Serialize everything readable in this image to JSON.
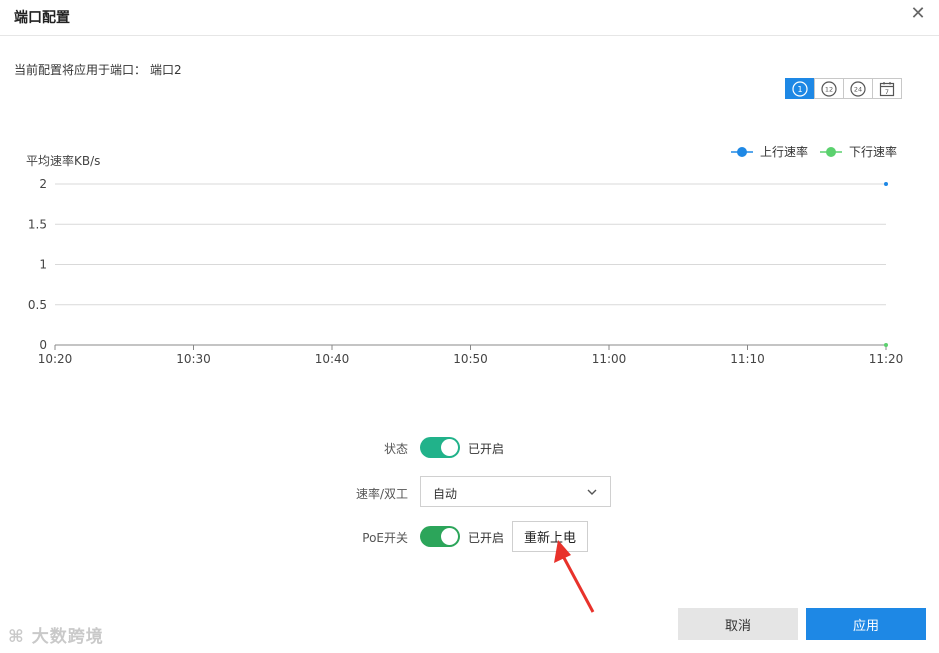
{
  "dialog": {
    "title": "端口配置",
    "close_glyph": "✕"
  },
  "port_info": {
    "label": "当前配置将应用于端口：",
    "port": "端口2"
  },
  "time_range": {
    "buttons": [
      {
        "icon": "clock-1-icon",
        "text": "1",
        "active": true
      },
      {
        "icon": "clock-12-icon",
        "text": "12",
        "active": false
      },
      {
        "icon": "clock-24-icon",
        "text": "24",
        "active": false
      },
      {
        "icon": "calendar-7-icon",
        "text": "7",
        "active": false
      }
    ]
  },
  "chart_data": {
    "type": "line",
    "ylabel": "平均速率KB/s",
    "xlabel": "",
    "x": [
      "10:20",
      "10:30",
      "10:40",
      "10:50",
      "11:00",
      "11:10",
      "11:20"
    ],
    "ylim": [
      0,
      2
    ],
    "yticks": [
      "2",
      "1.5",
      "1",
      "0.5",
      "0"
    ],
    "grid": true,
    "legend_position": "top-right",
    "series": [
      {
        "name": "上行速率",
        "color": "#1e88e5",
        "points": [
          {
            "x": "11:20",
            "y": 2
          }
        ]
      },
      {
        "name": "下行速率",
        "color": "#5bd16e",
        "points": [
          {
            "x": "11:20",
            "y": 0
          }
        ]
      }
    ]
  },
  "form": {
    "status": {
      "label": "状态",
      "state_text": "已开启",
      "on": true
    },
    "speed_duplex": {
      "label": "速率/双工",
      "value": "自动"
    },
    "poe": {
      "label": "PoE开关",
      "state_text": "已开启",
      "on": true,
      "repower_label": "重新上电"
    }
  },
  "footer": {
    "cancel_label": "取消",
    "apply_label": "应用"
  },
  "watermark": {
    "text": "大数跨境"
  },
  "colors": {
    "accent": "#1e88e5",
    "status_toggle": "#21b28a",
    "poe_toggle": "#2ca55a",
    "annotation_arrow": "#e8322b"
  }
}
